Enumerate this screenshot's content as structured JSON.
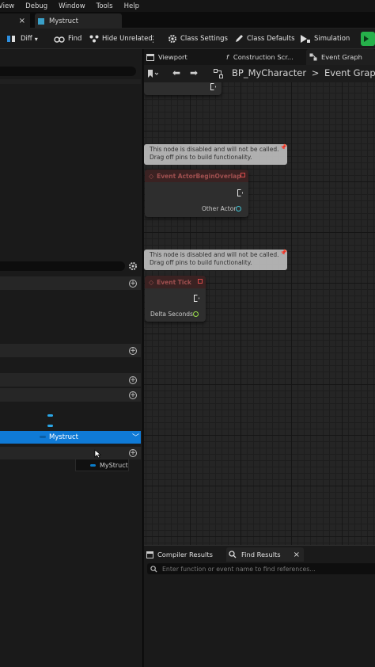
{
  "menu": [
    "View",
    "Debug",
    "Window",
    "Tools",
    "Help"
  ],
  "tabs": {
    "first_close": "×",
    "asset_tab": "Mystruct"
  },
  "toolbar": {
    "diff": "Diff",
    "find": "Find",
    "hide_unrelated": "Hide Unrelated",
    "class_settings": "Class Settings",
    "class_defaults": "Class Defaults",
    "simulation": "Simulation"
  },
  "left_panel": {
    "selected_variable": "Mystruct",
    "hover_tooltip_type": "MyStruct"
  },
  "graph_tabs": {
    "viewport": "Viewport",
    "construction": "Construction Scr...",
    "event_graph": "Event Graph"
  },
  "breadcrumb": {
    "blueprint": "BP_MyCharacter",
    "separator": ">",
    "graph": "Event Graph"
  },
  "nodes": [
    {
      "comment": "This node is disabled and will not be called.\nDrag off pins to build functionality.",
      "title": "Event ActorBeginOverlap",
      "pin": "Other Actor"
    },
    {
      "comment": "This node is disabled and will not be called.\nDrag off pins to build functionality.",
      "title": "Event Tick",
      "pin": "Delta Seconds"
    }
  ],
  "bottom_tabs": {
    "compiler_results": "Compiler Results",
    "find_results": "Find Results",
    "close": "×"
  },
  "find_placeholder": "Enter function or event name to find references...",
  "colors": {
    "selection": "#0f7ad6",
    "struct_pin": "#0a7cc9",
    "event_node_header": "#3a2222",
    "float_pin": "#9be04a",
    "object_pin": "#40c0d0",
    "compile_button": "#26b04a"
  }
}
